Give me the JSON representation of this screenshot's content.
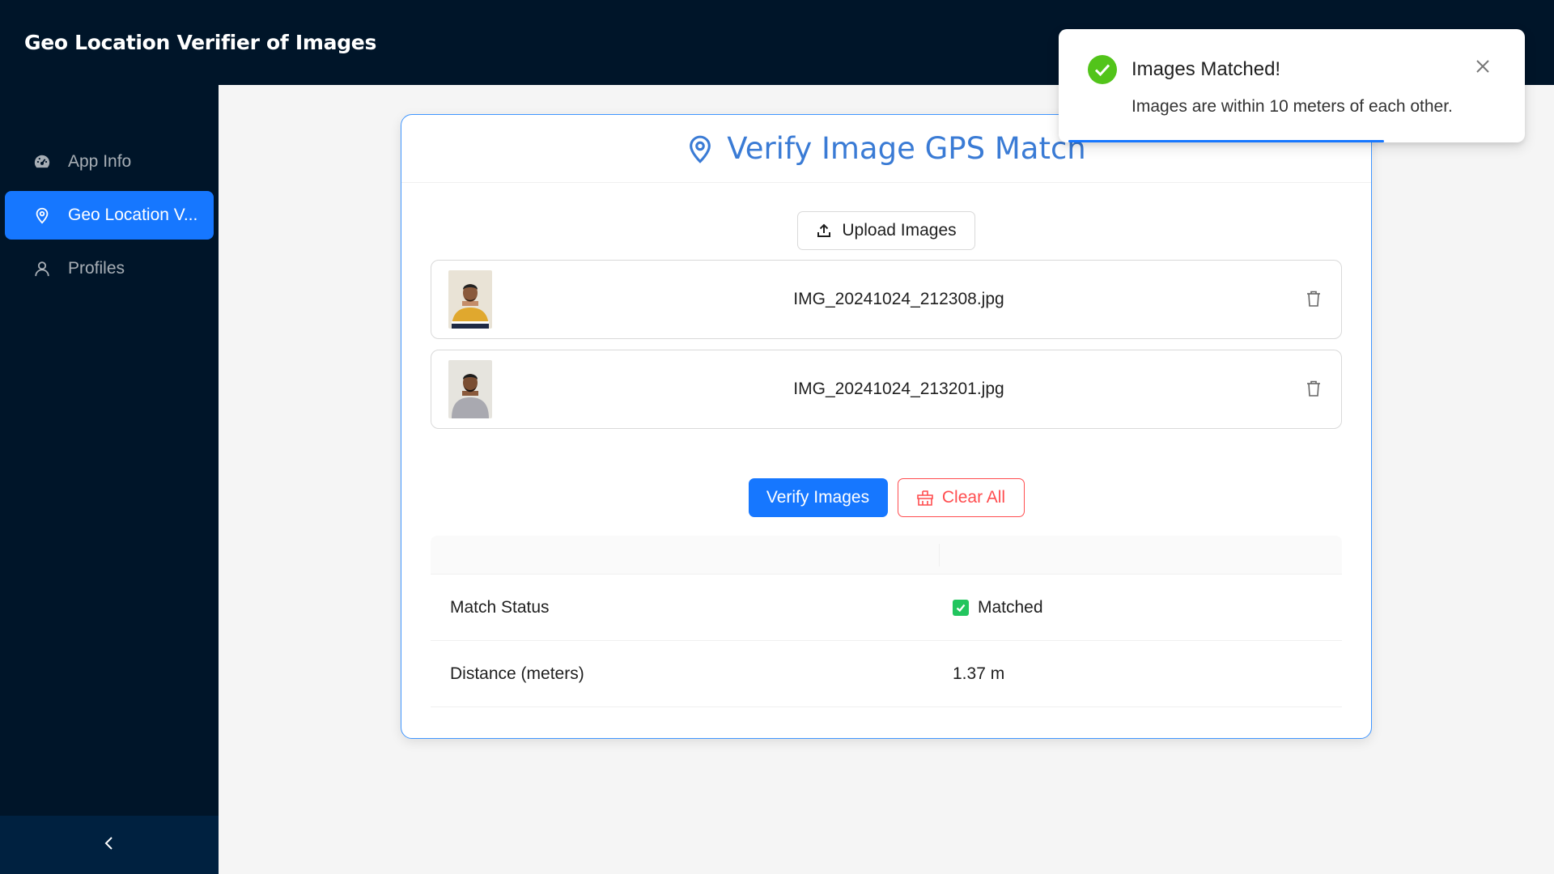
{
  "app": {
    "title": "Geo Location Verifier of Images"
  },
  "sidebar": {
    "items": [
      {
        "label": "App Info",
        "icon": "dashboard-icon",
        "active": false
      },
      {
        "label": "Geo Location V...",
        "icon": "location-pin-icon",
        "active": true
      },
      {
        "label": "Profiles",
        "icon": "user-icon",
        "active": false
      }
    ],
    "collapse_icon": "chevron-left-icon"
  },
  "card": {
    "title": "Verify Image GPS Match",
    "title_icon": "location-pin-icon",
    "upload_label": "Upload Images",
    "files": [
      {
        "name": "IMG_20241024_212308.jpg",
        "thumb_shirt": "#e0a82e"
      },
      {
        "name": "IMG_20241024_213201.jpg",
        "thumb_shirt": "#a9a9b0"
      }
    ],
    "verify_label": "Verify Images",
    "clear_label": "Clear All"
  },
  "results": {
    "rows": [
      {
        "label": "Match Status",
        "value": "Matched"
      },
      {
        "label": "Distance (meters)",
        "value": "1.37 m"
      }
    ]
  },
  "toast": {
    "title": "Images Matched!",
    "message": "Images are within 10 meters of each other.",
    "icon": "check-circle-icon"
  },
  "colors": {
    "header_bg": "#001529",
    "primary": "#1677ff",
    "title_blue": "#3a7bd5",
    "danger": "#ff4d4f",
    "success": "#52c41a"
  }
}
